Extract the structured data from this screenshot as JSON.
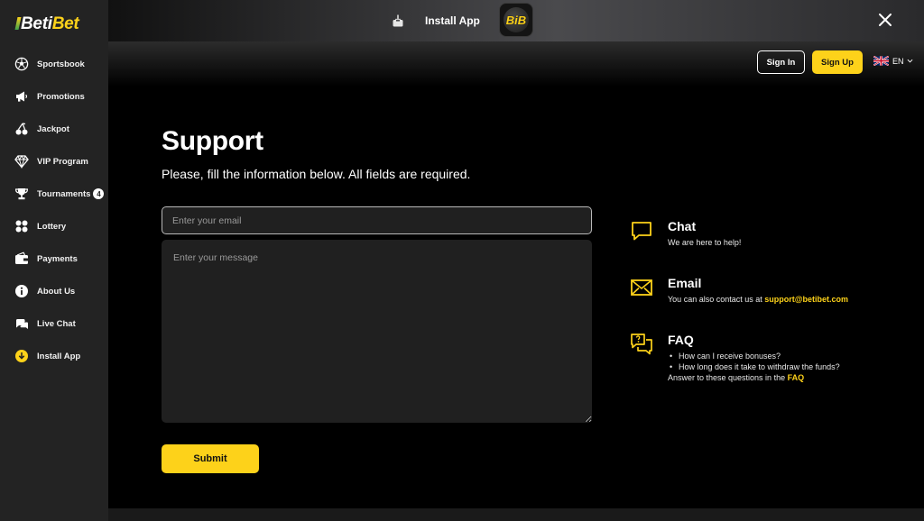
{
  "brand": {
    "name_part1": "Beti",
    "name_part2": "Bet"
  },
  "colors": {
    "accent": "#fdd21a",
    "sidebar_bg": "#232323",
    "main_bg": "#000000",
    "input_bg": "#202020"
  },
  "sidebar": {
    "items": [
      {
        "label": "Sportsbook",
        "icon": "soccer-ball-icon"
      },
      {
        "label": "Promotions",
        "icon": "megaphone-icon"
      },
      {
        "label": "Jackpot",
        "icon": "cherries-icon"
      },
      {
        "label": "VIP Program",
        "icon": "diamond-icon"
      },
      {
        "label": "Tournaments",
        "icon": "trophy-icon",
        "badge": "4"
      },
      {
        "label": "Lottery",
        "icon": "lottery-balls-icon"
      },
      {
        "label": "Payments",
        "icon": "wallet-icon"
      },
      {
        "label": "About Us",
        "icon": "info-icon"
      },
      {
        "label": "Live Chat",
        "icon": "chat-bubbles-icon"
      },
      {
        "label": "Install App",
        "icon": "download-icon"
      }
    ]
  },
  "topbar": {
    "install_label": "Install App",
    "app_tile_text": "BiB"
  },
  "header": {
    "signin_label": "Sign In",
    "signup_label": "Sign Up",
    "language": "EN"
  },
  "form": {
    "title": "Support",
    "subtitle": "Please, fill the information below. All fields are required.",
    "email_placeholder": "Enter your email",
    "message_placeholder": "Enter your message",
    "submit_label": "Submit"
  },
  "contacts": {
    "chat": {
      "title": "Chat",
      "text": "We are here to help!"
    },
    "email": {
      "title": "Email",
      "text": "You can also contact us at ",
      "address": "support@betibet.com"
    },
    "faq": {
      "title": "FAQ",
      "items": [
        "How can I receive bonuses?",
        "How long does it take to withdraw the funds?"
      ],
      "footer_text": "Answer to these questions in the ",
      "footer_link": "FAQ"
    }
  }
}
